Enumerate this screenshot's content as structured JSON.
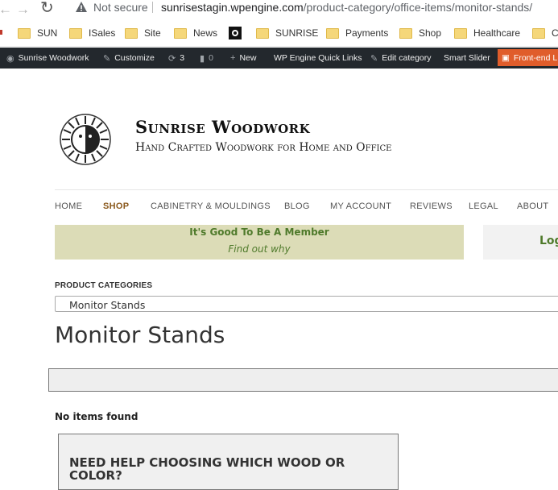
{
  "browser": {
    "security_label": "Not secure",
    "url_host": "sunrisestagin.wpengine.com",
    "url_path": "/product-category/office-items/monitor-stands/"
  },
  "bookmarks": [
    {
      "label": "SUN",
      "icon": "folder-icon"
    },
    {
      "label": "ISales",
      "icon": "folder-icon"
    },
    {
      "label": "Site",
      "icon": "folder-icon"
    },
    {
      "label": "News",
      "icon": "folder-icon"
    },
    {
      "label": "",
      "icon": "sun-favicon"
    },
    {
      "label": "SUNRISE",
      "icon": "folder-icon"
    },
    {
      "label": "Payments",
      "icon": "folder-icon"
    },
    {
      "label": "Shop",
      "icon": "folder-icon"
    },
    {
      "label": "Healthcare",
      "icon": "folder-icon"
    },
    {
      "label": "Ch",
      "icon": "folder-icon"
    }
  ],
  "adminbar": {
    "site_name": "Sunrise Woodwork",
    "customize": "Customize",
    "updates_count": "3",
    "comments_count": "0",
    "new_label": "New",
    "quick_links": "WP Engine Quick Links",
    "edit_category": "Edit category",
    "smart_slider": "Smart Slider",
    "front_end": "Front-end L"
  },
  "site": {
    "title": "Sunrise Woodwork",
    "tagline": "Hand Crafted Woodwork for Home and Office"
  },
  "menu": [
    "HOME",
    "SHOP",
    "CABINETRY & MOULDINGS",
    "BLOG",
    "MY ACCOUNT",
    "REVIEWS",
    "LEGAL",
    "ABOUT"
  ],
  "member_banner": {
    "title": "It's Good To Be A Member",
    "link": "Find out why"
  },
  "login_banner": {
    "label": "Log"
  },
  "categories": {
    "label": "PRODUCT CATEGORIES",
    "selected": "Monitor Stands"
  },
  "page": {
    "title": "Monitor Stands",
    "no_items": "No items found"
  },
  "help_box": {
    "title": "NEED HELP CHOOSING WHICH WOOD OR COLOR?"
  },
  "colors": {
    "accent_green": "#4f7a2b",
    "shop_brown": "#8b5a1e",
    "adminbar_bg": "#23282d",
    "front_end_orange": "#e05d2b"
  }
}
